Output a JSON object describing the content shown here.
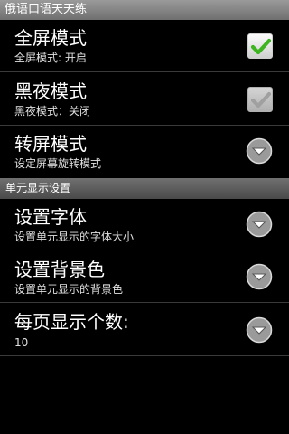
{
  "app": {
    "title": "俄语口语天天练"
  },
  "prefs_top": [
    {
      "title": "全屏模式",
      "summary": "全屏模式: 开启",
      "control": "checkbox",
      "checked": true,
      "enabled": true
    },
    {
      "title": "黑夜模式",
      "summary": "黑夜模式：关闭",
      "control": "checkbox",
      "checked": true,
      "enabled": false
    },
    {
      "title": "转屏模式",
      "summary": "设定屏幕旋转模式",
      "control": "dropdown"
    }
  ],
  "category": {
    "label": "单元显示设置"
  },
  "prefs_bottom": [
    {
      "title": "设置字体",
      "summary": "设置单元显示的字体大小",
      "control": "dropdown"
    },
    {
      "title": "设置背景色",
      "summary": "设置单元显示的背景色",
      "control": "dropdown"
    },
    {
      "title": "每页显示个数:",
      "summary": "10",
      "control": "dropdown"
    }
  ],
  "colors": {
    "check_enabled": "#3cb521",
    "check_disabled": "#bdbdbd",
    "dropdown_bg": "#9a9a9a"
  },
  "icons": {
    "checkbox": "checkmark-icon",
    "dropdown": "chevron-down-circle-icon"
  }
}
